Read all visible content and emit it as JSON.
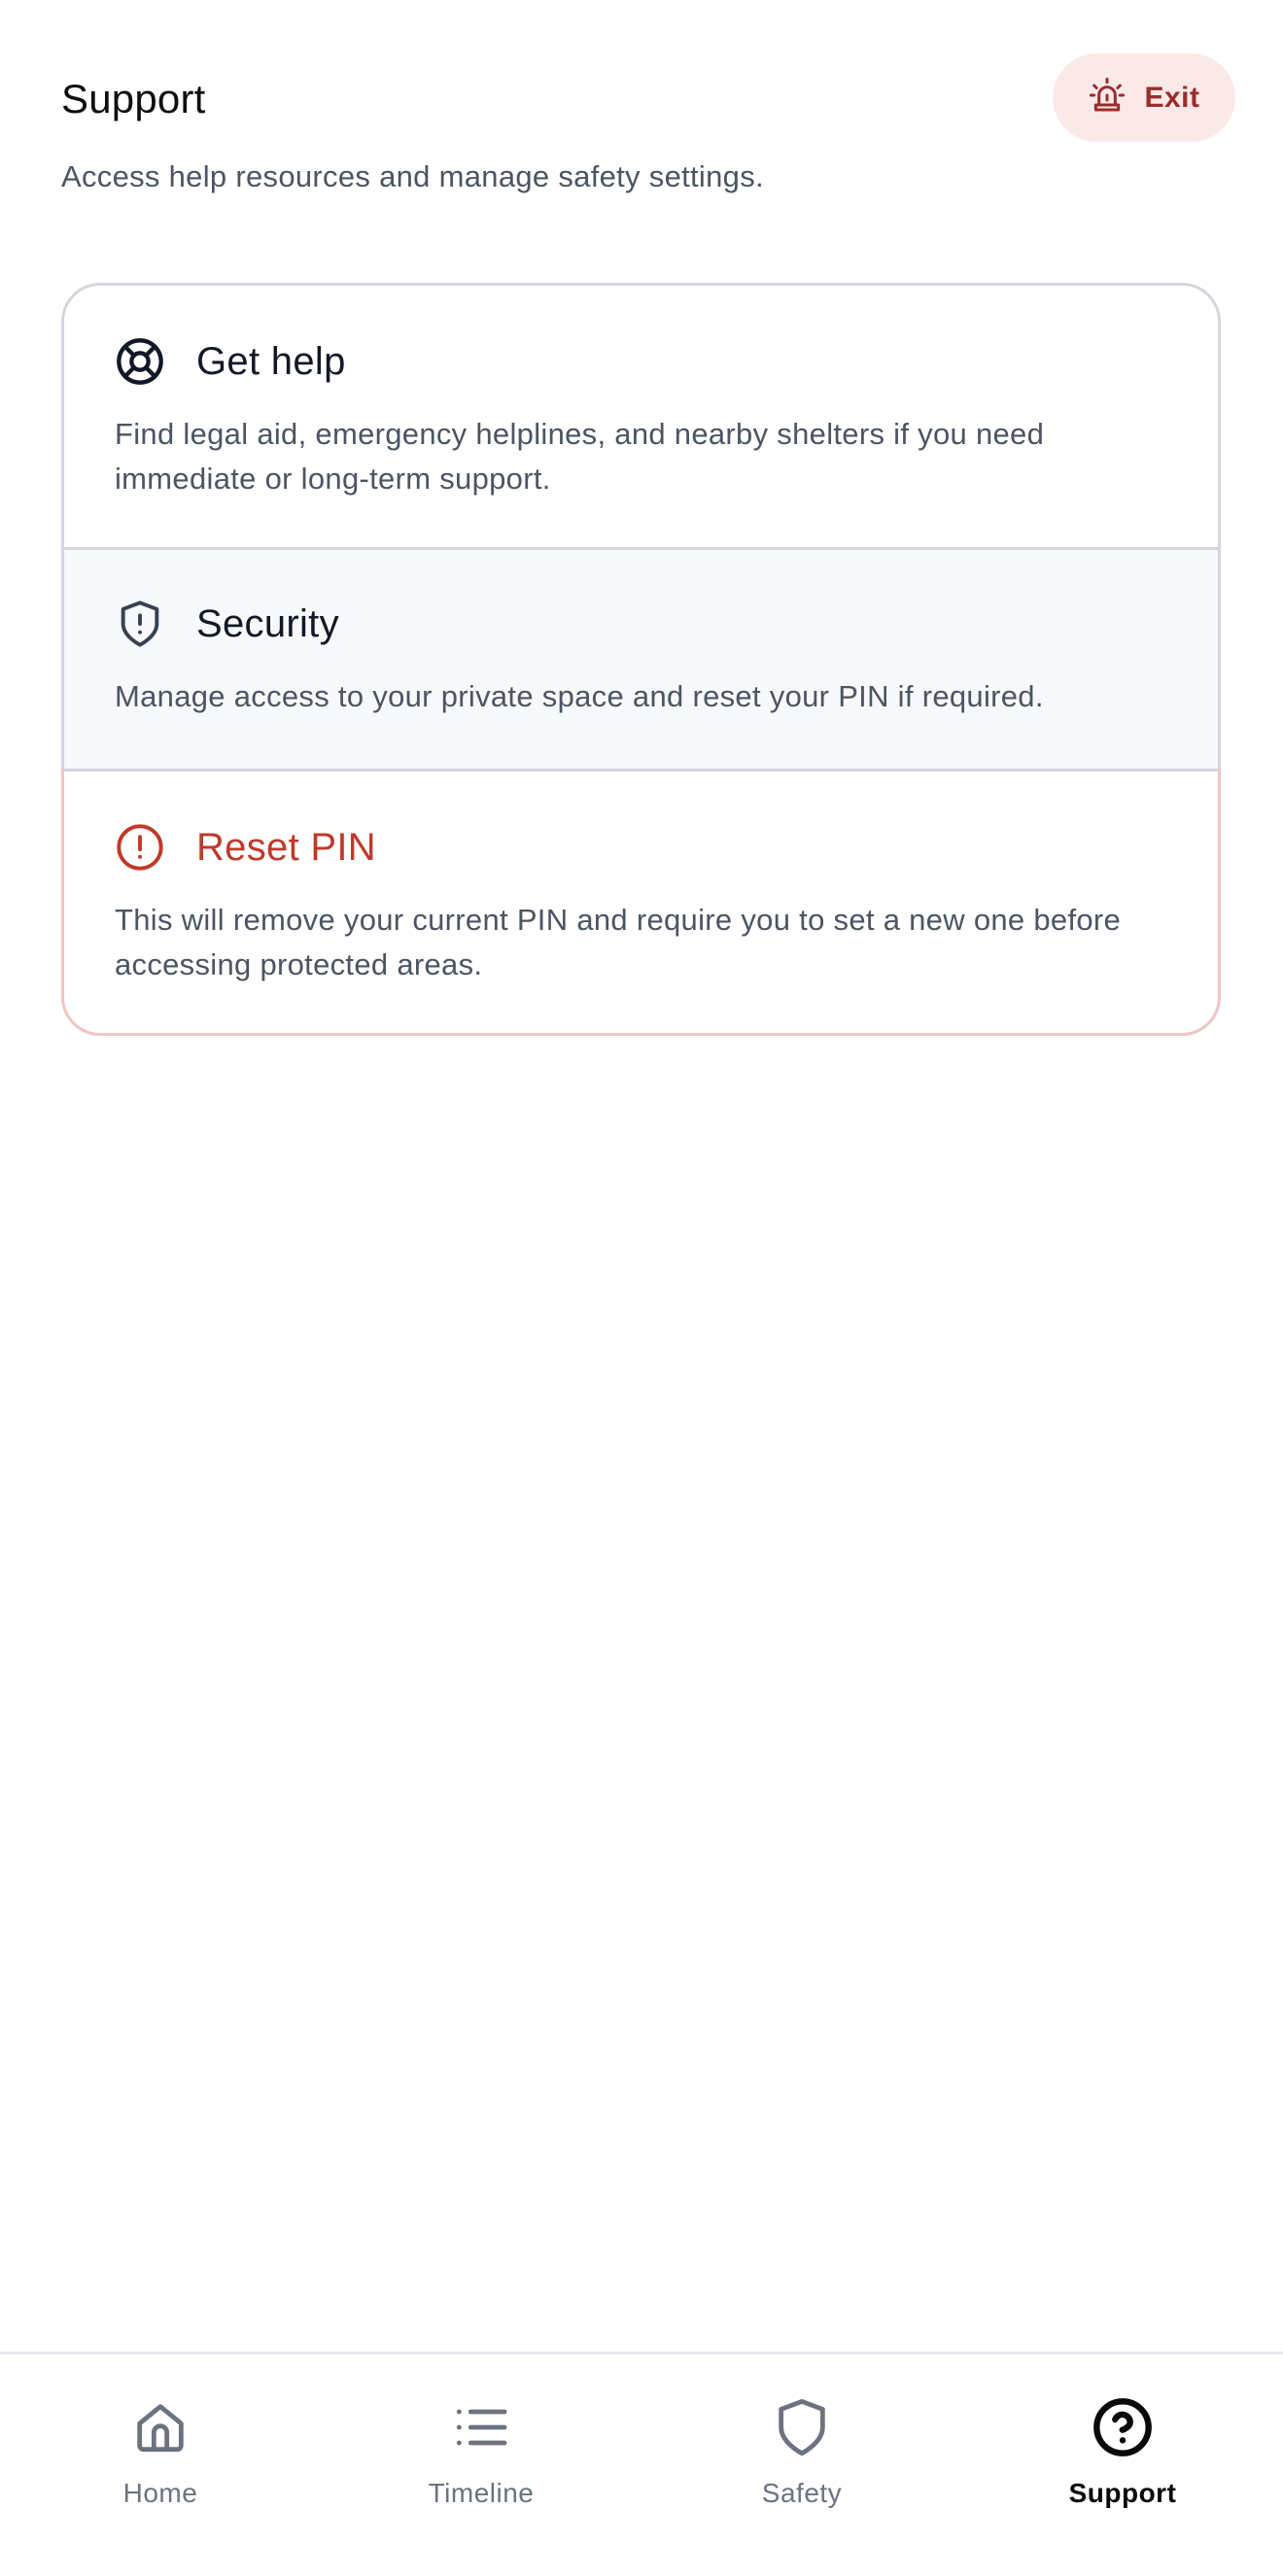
{
  "header": {
    "title": "Support",
    "subtitle": "Access help resources and manage safety settings.",
    "exit_label": "Exit",
    "exit_icon": "siren-icon"
  },
  "items": [
    {
      "icon": "lifebuoy-icon",
      "title": "Get help",
      "description": "Find legal aid, emergency helplines, and nearby shelters if you need immediate or long-term support."
    },
    {
      "icon": "shield-alert-icon",
      "title": "Security",
      "description": "Manage access to your private space and reset your PIN if required."
    },
    {
      "icon": "alert-circle-icon",
      "title": "Reset PIN",
      "description": "This will remove your current PIN and require you to set a new one before accessing protected areas."
    }
  ],
  "nav": [
    {
      "label": "Home",
      "icon": "home-icon",
      "active": false
    },
    {
      "label": "Timeline",
      "icon": "list-icon",
      "active": false
    },
    {
      "label": "Safety",
      "icon": "shield-icon",
      "active": false
    },
    {
      "label": "Support",
      "icon": "help-circle-icon",
      "active": true
    }
  ],
  "colors": {
    "danger": "#c0392b",
    "exit_bg": "#fbe9e8",
    "muted_text": "#4b5563",
    "border": "#d4d6dc",
    "active_nav": "#0a0a0a"
  }
}
